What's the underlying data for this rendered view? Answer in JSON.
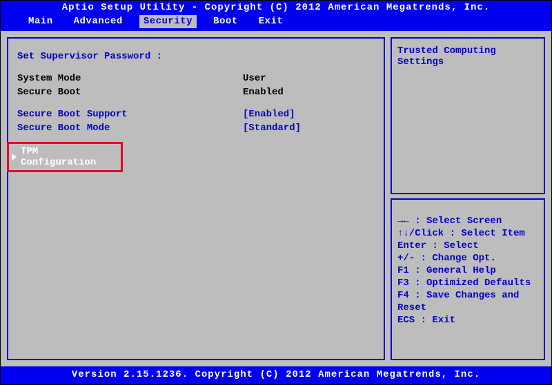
{
  "header": {
    "title": "Aptio  Setup  Utility  -  Copyright  (C)  2012  American  Megatrends,  Inc."
  },
  "tabs": {
    "items": [
      {
        "label": "Main",
        "active": false
      },
      {
        "label": "Advanced",
        "active": false
      },
      {
        "label": "Security",
        "active": true
      },
      {
        "label": "Boot",
        "active": false
      },
      {
        "label": "Exit",
        "active": false
      }
    ]
  },
  "left": {
    "set_supervisor": "Set Supervisor Password :",
    "system_mode_label": "System Mode",
    "system_mode_value": "User",
    "secure_boot_label": "Secure Boot",
    "secure_boot_value": "Enabled",
    "secure_boot_support_label": "Secure Boot Support",
    "secure_boot_support_value": "[Enabled]",
    "secure_boot_mode_label": "Secure Boot Mode",
    "secure_boot_mode_value": "[Standard]",
    "tpm_config": "TPM Configuration"
  },
  "right": {
    "help_title": "Trusted Computing Settings",
    "keys": [
      "→← : Select Screen",
      "↑↓/Click : Select Item",
      "Enter : Select",
      "+/- : Change Opt.",
      "F1 : General Help",
      "F3 : Optimized Defaults",
      "F4 : Save Changes and Reset",
      "ECS : Exit"
    ]
  },
  "footer": {
    "text": "Version 2.15.1236.  Copyright (C) 2012 American Megatrends,  Inc."
  }
}
